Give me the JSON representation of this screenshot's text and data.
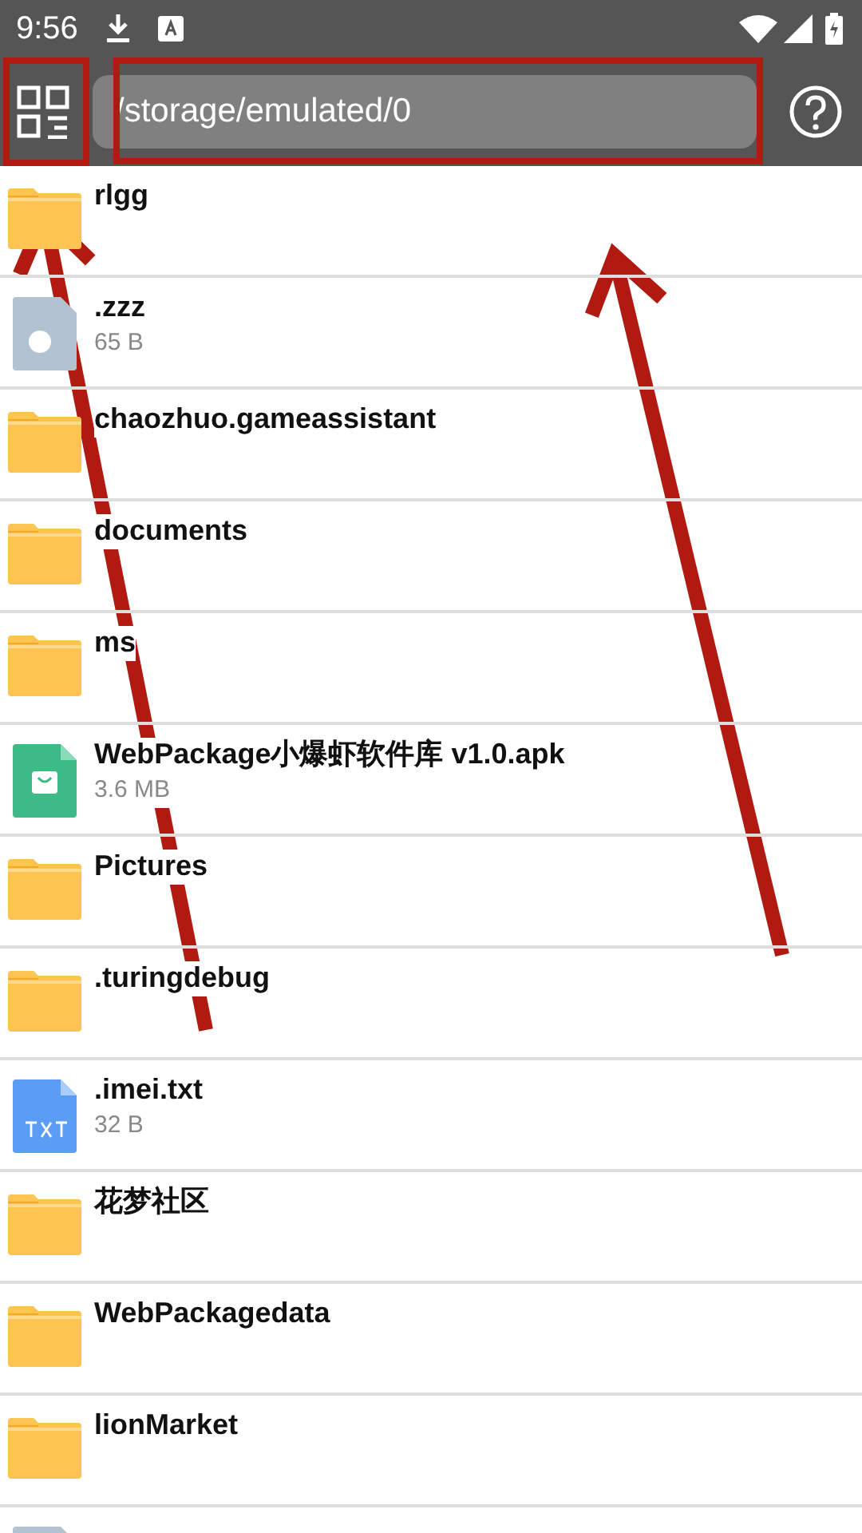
{
  "status_bar": {
    "time": "9:56"
  },
  "toolbar": {
    "path": "/storage/emulated/0"
  },
  "files": [
    {
      "kind": "folder",
      "name": "rlgg"
    },
    {
      "kind": "unknown",
      "name": ".zzz",
      "size": "65 B"
    },
    {
      "kind": "folder",
      "name": "chaozhuo.gameassistant"
    },
    {
      "kind": "folder",
      "name": "documents"
    },
    {
      "kind": "folder",
      "name": "ms"
    },
    {
      "kind": "apk",
      "name": "WebPackage小爆虾软件库 v1.0.apk",
      "size": "3.6 MB"
    },
    {
      "kind": "folder",
      "name": "Pictures"
    },
    {
      "kind": "folder",
      "name": ".turingdebug"
    },
    {
      "kind": "txt",
      "name": ".imei.txt",
      "size": "32 B"
    },
    {
      "kind": "folder",
      "name": "花梦社区"
    },
    {
      "kind": "folder",
      "name": "WebPackagedata"
    },
    {
      "kind": "folder",
      "name": "lionMarket"
    },
    {
      "kind": "unknown"
    }
  ]
}
